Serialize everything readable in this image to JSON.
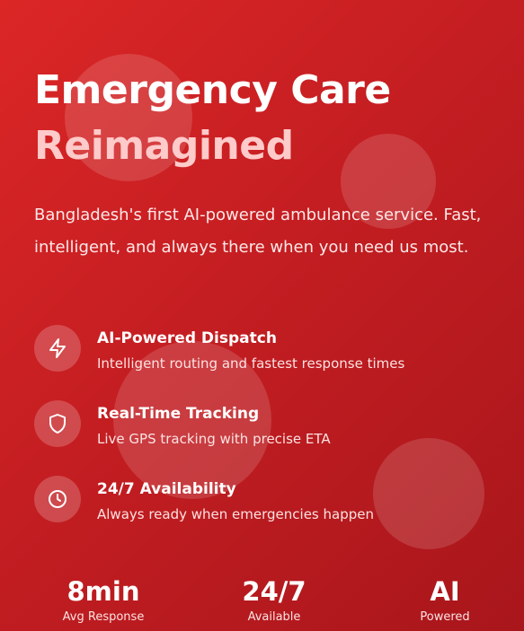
{
  "hero": {
    "title_line1": "Emergency Care",
    "title_line2": "Reimagined",
    "subtitle": "Bangladesh's first AI-powered ambulance service. Fast, intelligent, and always there when you need us most."
  },
  "features": [
    {
      "icon": "lightning-icon",
      "title": "AI-Powered Dispatch",
      "description": "Intelligent routing and fastest response times"
    },
    {
      "icon": "shield-icon",
      "title": "Real-Time Tracking",
      "description": "Live GPS tracking with precise ETA"
    },
    {
      "icon": "clock-icon",
      "title": "24/7 Availability",
      "description": "Always ready when emergencies happen"
    }
  ],
  "stats": [
    {
      "value": "8min",
      "label": "Avg Response"
    },
    {
      "value": "24/7",
      "label": "Available"
    },
    {
      "value": "AI",
      "label": "Powered"
    }
  ],
  "colors": {
    "gradient_start": "#dc2626",
    "gradient_end": "#a8161b",
    "title_accent": "#fecaca"
  }
}
